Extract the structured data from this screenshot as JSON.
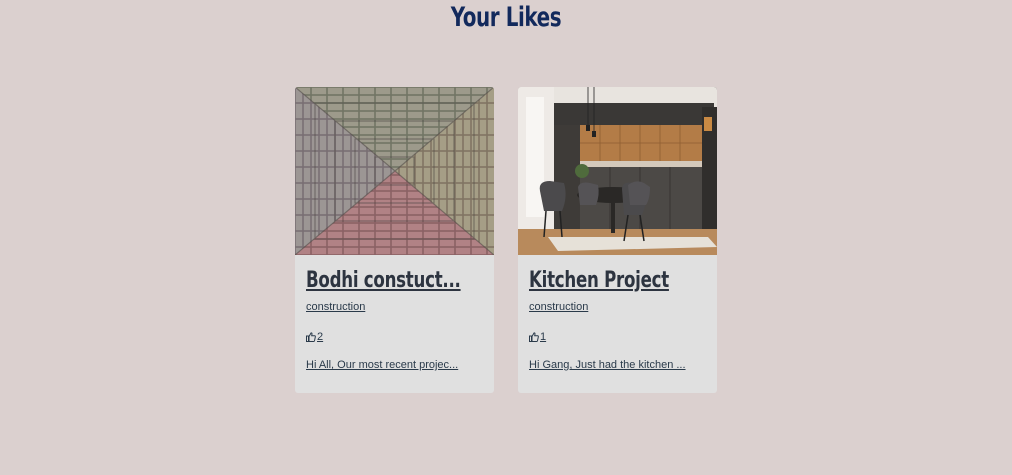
{
  "page": {
    "title": "Your Likes"
  },
  "cards": [
    {
      "title": "Bodhi constuct...",
      "category": "construction",
      "likes": "2",
      "excerpt": "Hi All, Our most recent projec...",
      "image": "brick-paving-photo"
    },
    {
      "title": "Kitchen Project",
      "category": "construction",
      "likes": "1",
      "excerpt": "Hi Gang, Just had the kitchen ...",
      "image": "kitchen-interior-photo"
    }
  ],
  "colors": {
    "background": "#dbd0cf",
    "title": "#12295c",
    "card": "#e0e0e0",
    "text": "#2a3a4a"
  }
}
